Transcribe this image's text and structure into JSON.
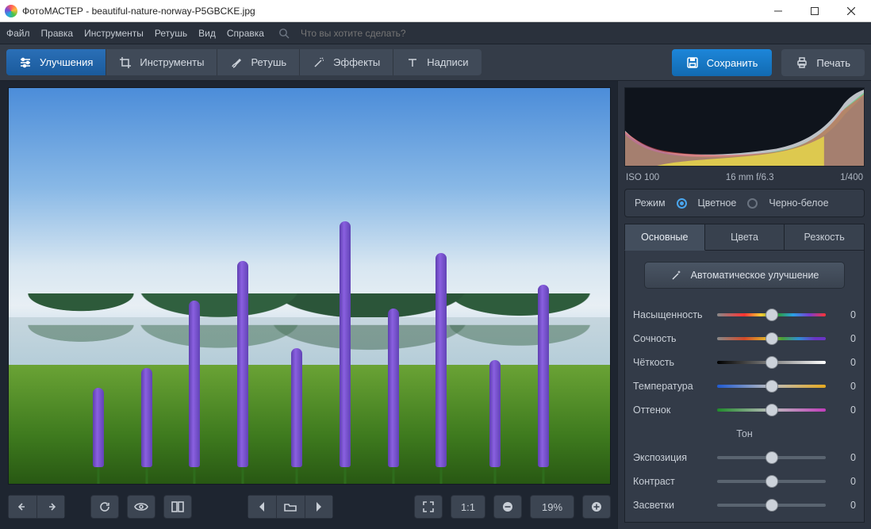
{
  "title": "ФотоМАСТЕР - beautiful-nature-norway-P5GBCKE.jpg",
  "menu": {
    "items": [
      "Файл",
      "Правка",
      "Инструменты",
      "Ретушь",
      "Вид",
      "Справка"
    ],
    "search_placeholder": "Что вы хотите сделать?"
  },
  "toolbar": {
    "tabs": [
      {
        "label": "Улучшения",
        "icon": "sliders"
      },
      {
        "label": "Инструменты",
        "icon": "crop"
      },
      {
        "label": "Ретушь",
        "icon": "brush"
      },
      {
        "label": "Эффекты",
        "icon": "wand"
      },
      {
        "label": "Надписи",
        "icon": "text"
      }
    ],
    "save_label": "Сохранить",
    "print_label": "Печать"
  },
  "meta": {
    "iso": "ISO 100",
    "lens": "16 mm f/6.3",
    "shutter": "1/400"
  },
  "mode": {
    "label": "Режим",
    "color": "Цветное",
    "bw": "Черно-белое"
  },
  "right_tabs": [
    "Основные",
    "Цвета",
    "Резкость"
  ],
  "auto_enhance": "Автоматическое улучшение",
  "tone_label": "Тон",
  "sliders": [
    {
      "label": "Насыщенность",
      "value": "0",
      "track": "sat",
      "pos": 50
    },
    {
      "label": "Сочность",
      "value": "0",
      "track": "vib",
      "pos": 50
    },
    {
      "label": "Чёткость",
      "value": "0",
      "track": "gray",
      "pos": 50
    },
    {
      "label": "Температура",
      "value": "0",
      "track": "temp",
      "pos": 50
    },
    {
      "label": "Оттенок",
      "value": "0",
      "track": "tint",
      "pos": 50
    }
  ],
  "tone_sliders": [
    {
      "label": "Экспозиция",
      "value": "0",
      "track": "neutral",
      "pos": 50
    },
    {
      "label": "Контраст",
      "value": "0",
      "track": "neutral",
      "pos": 50
    },
    {
      "label": "Засветки",
      "value": "0",
      "track": "neutral",
      "pos": 50
    }
  ],
  "bottom": {
    "ratio": "1:1",
    "zoom": "19%"
  }
}
